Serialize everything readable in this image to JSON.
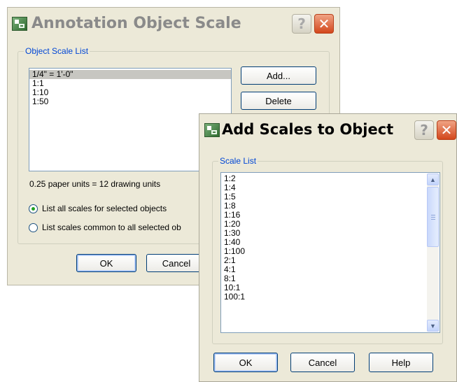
{
  "annotation_dialog": {
    "title": "Annotation Object Scale",
    "group_label": "Object Scale List",
    "scales": [
      {
        "label": "1/4\" = 1'-0\"",
        "selected": true
      },
      {
        "label": "1:1",
        "selected": false
      },
      {
        "label": "1:10",
        "selected": false
      },
      {
        "label": "1:50",
        "selected": false
      }
    ],
    "add_button": "Add...",
    "delete_button": "Delete",
    "units_text": "0.25 paper units = 12 drawing units",
    "radio_all": "List all scales for selected objects",
    "radio_common": "List scales common to all selected ob",
    "selected_radio": "all",
    "ok_button": "OK",
    "cancel_button": "Cancel"
  },
  "add_scales_dialog": {
    "title": "Add Scales to Object",
    "group_label": "Scale List",
    "scales": [
      "1:2",
      "1:4",
      "1:5",
      "1:8",
      "1:16",
      "1:20",
      "1:30",
      "1:40",
      "1:100",
      "2:1",
      "4:1",
      "8:1",
      "10:1",
      "100:1"
    ],
    "ok_button": "OK",
    "cancel_button": "Cancel",
    "help_button": "Help"
  },
  "icons": {
    "help": "?",
    "close": "✕",
    "scroll_up": "▲",
    "scroll_down": "▼"
  },
  "colors": {
    "dialog_bg": "#ece9d8",
    "group_label": "#0046d5",
    "close_button": "#d3471c",
    "selection": "#c7c6c1"
  }
}
